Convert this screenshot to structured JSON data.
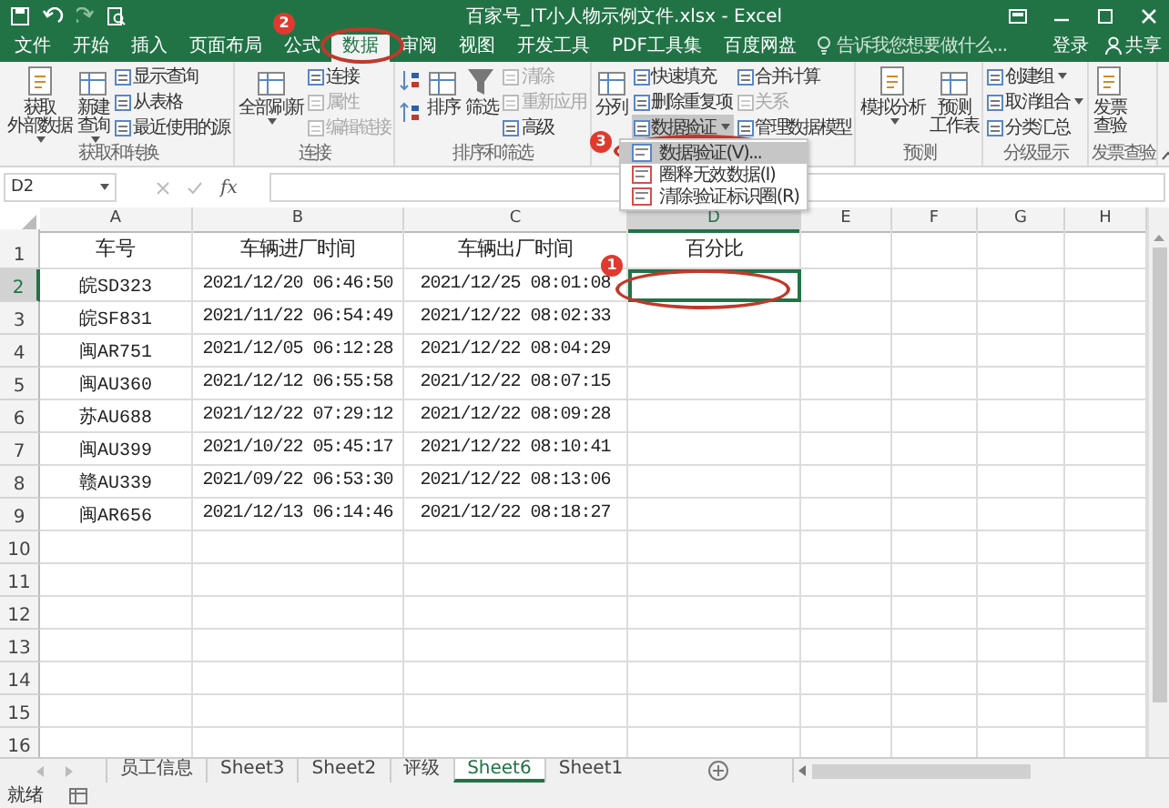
{
  "window": {
    "title": "百家号_IT小人物示例文件.xlsx - Excel"
  },
  "tabs": [
    {
      "label": "文件",
      "selected": false
    },
    {
      "label": "开始",
      "selected": false
    },
    {
      "label": "插入",
      "selected": false
    },
    {
      "label": "页面布局",
      "selected": false
    },
    {
      "label": "公式",
      "selected": false
    },
    {
      "label": "数据",
      "selected": true
    },
    {
      "label": "审阅",
      "selected": false
    },
    {
      "label": "视图",
      "selected": false
    },
    {
      "label": "开发工具",
      "selected": false
    },
    {
      "label": "PDF工具集",
      "selected": false
    },
    {
      "label": "百度网盘",
      "selected": false
    }
  ],
  "tell_me": {
    "placeholder": "告诉我您想要做什么..."
  },
  "account": {
    "sign_in": "登录",
    "share": "共享"
  },
  "ribbon_groups": [
    {
      "label": "获取和转换",
      "columns": [
        [
          {
            "kind": "big",
            "label": [
              "获取",
              "外部数据"
            ],
            "dropdown": true,
            "disabled": false
          }
        ],
        [
          {
            "kind": "big",
            "label": [
              "新建",
              "查询"
            ],
            "dropdown": true,
            "disabled": false
          }
        ],
        [
          {
            "kind": "small",
            "label": "显示查询",
            "disabled": false
          },
          {
            "kind": "small",
            "label": "从表格",
            "disabled": false
          },
          {
            "kind": "small",
            "label": "最近使用的源",
            "disabled": false
          }
        ]
      ]
    },
    {
      "label": "连接",
      "columns": [
        [
          {
            "kind": "big",
            "label": [
              "全部刷新"
            ],
            "dropdown": true,
            "disabled": false
          }
        ],
        [
          {
            "kind": "small",
            "label": "连接",
            "disabled": false
          },
          {
            "kind": "small",
            "label": "属性",
            "disabled": true
          },
          {
            "kind": "small",
            "label": "编辑链接",
            "disabled": true
          }
        ]
      ]
    },
    {
      "label": "排序和筛选",
      "columns": [
        [
          {
            "kind": "sort_up"
          },
          {
            "kind": "sort_down"
          }
        ],
        [
          {
            "kind": "big",
            "label": [
              "排序"
            ],
            "disabled": false
          }
        ],
        [
          {
            "kind": "big",
            "label": [
              "筛选"
            ],
            "disabled": false
          }
        ],
        [
          {
            "kind": "small",
            "label": "清除",
            "disabled": true
          },
          {
            "kind": "small",
            "label": "重新应用",
            "disabled": true
          },
          {
            "kind": "small",
            "label": "高级",
            "disabled": false
          }
        ]
      ]
    },
    {
      "columns": [
        [
          {
            "kind": "big",
            "label": [
              "分列"
            ],
            "disabled": false
          }
        ],
        [
          {
            "kind": "small",
            "label": "快速填充",
            "disabled": false
          },
          {
            "kind": "small",
            "label": "删除重复项",
            "disabled": false
          },
          {
            "kind": "small",
            "label": "数据验证",
            "dropdown": true,
            "expanded": true,
            "disabled": false
          }
        ],
        [
          {
            "kind": "small",
            "label": "合并计算",
            "disabled": false
          },
          {
            "kind": "small",
            "label": "关系",
            "disabled": true
          },
          {
            "kind": "small",
            "label": "管理数据模型",
            "disabled": false
          }
        ]
      ]
    },
    {
      "label": "预测",
      "columns": [
        [
          {
            "kind": "big",
            "label": [
              "模拟分析"
            ],
            "dropdown": true,
            "disabled": false
          }
        ],
        [
          {
            "kind": "big",
            "label": [
              "预测",
              "工作表"
            ],
            "disabled": false
          }
        ]
      ]
    },
    {
      "label": "分级显示",
      "columns": [
        [
          {
            "kind": "small",
            "label": "创建组",
            "dropdown": true,
            "disabled": false
          },
          {
            "kind": "small",
            "label": "取消组合",
            "dropdown": true,
            "disabled": false
          },
          {
            "kind": "small",
            "label": "分类汇总",
            "disabled": false
          }
        ]
      ]
    },
    {
      "label": "发票查验",
      "columns": [
        [
          {
            "kind": "big",
            "label": [
              "发票",
              "查验"
            ],
            "disabled": false
          }
        ]
      ]
    }
  ],
  "dropdown_menu": {
    "items": [
      {
        "label": "数据验证(V)...",
        "selected": true
      },
      {
        "label": "圈释无效数据(I)",
        "selected": false
      },
      {
        "label": "清除验证标识圈(R)",
        "selected": false
      }
    ]
  },
  "formula_bar": {
    "name_box": "D2",
    "fx": "fx"
  },
  "columns": [
    {
      "label": "A",
      "selected": false
    },
    {
      "label": "B",
      "selected": false
    },
    {
      "label": "C",
      "selected": false
    },
    {
      "label": "D",
      "selected": true
    },
    {
      "label": "E",
      "selected": false
    },
    {
      "label": "F",
      "selected": false
    },
    {
      "label": "G",
      "selected": false
    },
    {
      "label": "H",
      "selected": false
    }
  ],
  "rows": [
    {
      "number": "1",
      "selected": false,
      "cells": [
        "车号",
        "车辆进厂时间",
        "车辆出厂时间",
        "百分比"
      ]
    },
    {
      "number": "2",
      "selected": true,
      "cells": [
        "皖SD323",
        "2021/12/20 06:46:50",
        "2021/12/25 08:01:08",
        ""
      ]
    },
    {
      "number": "3",
      "selected": false,
      "cells": [
        "皖SF831",
        "2021/11/22 06:54:49",
        "2021/12/22 08:02:33",
        ""
      ]
    },
    {
      "number": "4",
      "selected": false,
      "cells": [
        "闽AR751",
        "2021/12/05 06:12:28",
        "2021/12/22 08:04:29",
        ""
      ]
    },
    {
      "number": "5",
      "selected": false,
      "cells": [
        "闽AU360",
        "2021/12/12 06:55:58",
        "2021/12/22 08:07:15",
        ""
      ]
    },
    {
      "number": "6",
      "selected": false,
      "cells": [
        "苏AU688",
        "2021/12/22 07:29:12",
        "2021/12/22 08:09:28",
        ""
      ]
    },
    {
      "number": "7",
      "selected": false,
      "cells": [
        "闽AU399",
        "2021/10/22 05:45:17",
        "2021/12/22 08:10:41",
        ""
      ]
    },
    {
      "number": "8",
      "selected": false,
      "cells": [
        "赣AU339",
        "2021/09/22 06:53:30",
        "2021/12/22 08:13:06",
        ""
      ]
    },
    {
      "number": "9",
      "selected": false,
      "cells": [
        "闽AR656",
        "2021/12/13 06:14:46",
        "2021/12/22 08:18:27",
        ""
      ]
    },
    {
      "number": "10",
      "selected": false,
      "cells": []
    },
    {
      "number": "11",
      "selected": false,
      "cells": []
    },
    {
      "number": "12",
      "selected": false,
      "cells": []
    },
    {
      "number": "13",
      "selected": false,
      "cells": []
    },
    {
      "number": "14",
      "selected": false,
      "cells": []
    },
    {
      "number": "15",
      "selected": false,
      "cells": []
    },
    {
      "number": "16",
      "selected": false,
      "cells": []
    }
  ],
  "sheets": [
    {
      "label": "员工信息",
      "selected": false
    },
    {
      "label": "Sheet3",
      "selected": false
    },
    {
      "label": "Sheet2",
      "selected": false
    },
    {
      "label": "评级",
      "selected": false
    },
    {
      "label": "Sheet6",
      "selected": true
    },
    {
      "label": "Sheet1",
      "selected": false
    }
  ],
  "status_bar": {
    "text": "就绪"
  },
  "markers": [
    {
      "number": "2"
    },
    {
      "number": "3"
    },
    {
      "number": "1"
    }
  ]
}
